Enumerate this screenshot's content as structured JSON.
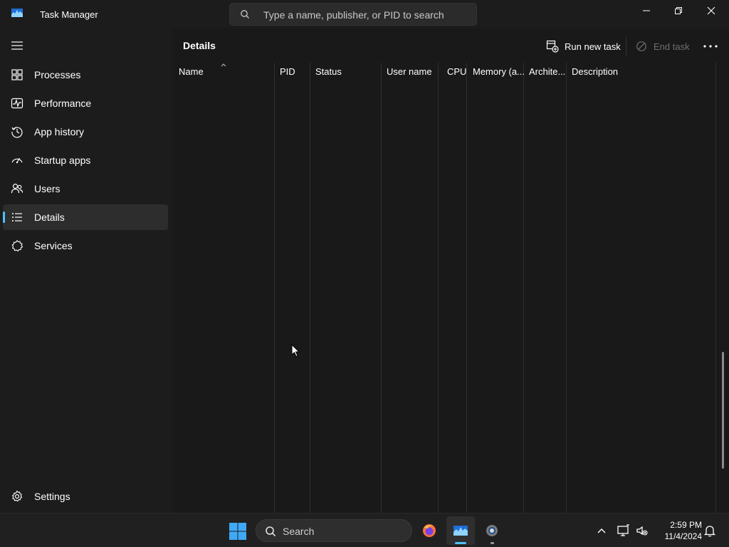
{
  "window": {
    "title": "Task Manager",
    "search_placeholder": "Type a name, publisher, or PID to search"
  },
  "sidebar": {
    "items": [
      {
        "label": "Processes",
        "icon": "processes-icon"
      },
      {
        "label": "Performance",
        "icon": "performance-icon"
      },
      {
        "label": "App history",
        "icon": "app-history-icon"
      },
      {
        "label": "Startup apps",
        "icon": "startup-apps-icon"
      },
      {
        "label": "Users",
        "icon": "users-icon"
      },
      {
        "label": "Details",
        "icon": "details-icon",
        "active": true
      },
      {
        "label": "Services",
        "icon": "services-icon"
      }
    ],
    "settings_label": "Settings"
  },
  "main": {
    "title": "Details",
    "run_new_task": "Run new task",
    "end_task": "End task",
    "columns": [
      {
        "label": "Name",
        "sorted": "ascending"
      },
      {
        "label": "PID"
      },
      {
        "label": "Status"
      },
      {
        "label": "User name"
      },
      {
        "label": "CPU"
      },
      {
        "label": "Memory (a..."
      },
      {
        "label": "Archite..."
      },
      {
        "label": "Description"
      }
    ],
    "rows": []
  },
  "taskbar": {
    "search_label": "Search",
    "apps": [
      "windows-start-icon",
      "firefox-icon",
      "task-manager-icon",
      "settings-gear-icon"
    ],
    "time": "2:59 PM",
    "date": "11/4/2024"
  },
  "colors": {
    "accent": "#4cc2ff",
    "background": "#1c1c1c",
    "main_background": "#191919",
    "taskbar": "#202020"
  }
}
